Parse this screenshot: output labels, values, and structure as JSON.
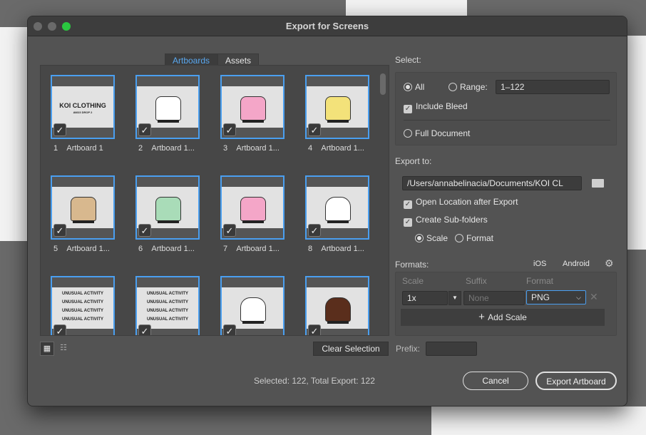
{
  "window": {
    "title": "Export for Screens"
  },
  "tabs": [
    {
      "label": "Artboards",
      "active": true
    },
    {
      "label": "Assets",
      "active": false
    }
  ],
  "artboards": [
    {
      "num": "1",
      "name": "Artboard 1",
      "kind": "title",
      "title": "KOI CLOTHING",
      "subtitle": "AW23 DROP 2"
    },
    {
      "num": "2",
      "name": "Artboard 1...",
      "kind": "sweater",
      "color": "#ffffff"
    },
    {
      "num": "3",
      "name": "Artboard 1...",
      "kind": "sweater",
      "color": "#f4a6c8"
    },
    {
      "num": "4",
      "name": "Artboard 1...",
      "kind": "sweater",
      "color": "#f3e27a"
    },
    {
      "num": "5",
      "name": "Artboard 1...",
      "kind": "sweater",
      "color": "#d8b88e"
    },
    {
      "num": "6",
      "name": "Artboard 1...",
      "kind": "sweater",
      "color": "#a9dcb8"
    },
    {
      "num": "7",
      "name": "Artboard 1...",
      "kind": "sweater",
      "color": "#f4a6c8"
    },
    {
      "num": "8",
      "name": "Artboard 1...",
      "kind": "hoodie",
      "color": "#ffffff"
    },
    {
      "num": "",
      "name": "",
      "kind": "text",
      "title": "UNUSUAL ACTIVITY"
    },
    {
      "num": "",
      "name": "",
      "kind": "text",
      "title": "UNUSUAL ACTIVITY"
    },
    {
      "num": "",
      "name": "",
      "kind": "hoodie",
      "color": "#ffffff"
    },
    {
      "num": "",
      "name": "",
      "kind": "hoodie",
      "color": "#5a2e1c"
    }
  ],
  "bottom_left": {
    "clear_selection": "Clear Selection",
    "prefix_label": "Prefix:",
    "prefix_value": "",
    "status": "Selected: 122, Total Export: 122"
  },
  "select": {
    "label": "Select:",
    "all": "All",
    "all_selected": true,
    "range": "Range:",
    "range_value": "1–122",
    "include_bleed": "Include Bleed",
    "include_bleed_checked": true,
    "full_document": "Full Document"
  },
  "export_to": {
    "label": "Export to:",
    "path": "/Users/annabelinacia/Documents/KOI CL",
    "open_location": "Open Location after Export",
    "open_location_checked": true,
    "sub_folders": "Create Sub-folders",
    "sub_folders_checked": true,
    "scale": "Scale",
    "format": "Format",
    "scale_selected": true
  },
  "formats": {
    "label": "Formats:",
    "ios": "iOS",
    "android": "Android",
    "headers": {
      "scale": "Scale",
      "suffix": "Suffix",
      "format": "Format"
    },
    "rows": [
      {
        "scale": "1x",
        "suffix_placeholder": "None",
        "format": "PNG"
      }
    ],
    "add_scale": "Add Scale"
  },
  "buttons": {
    "cancel": "Cancel",
    "export": "Export Artboard"
  },
  "colors": {
    "accent": "#4a9ff0",
    "window_bg": "#535353"
  }
}
